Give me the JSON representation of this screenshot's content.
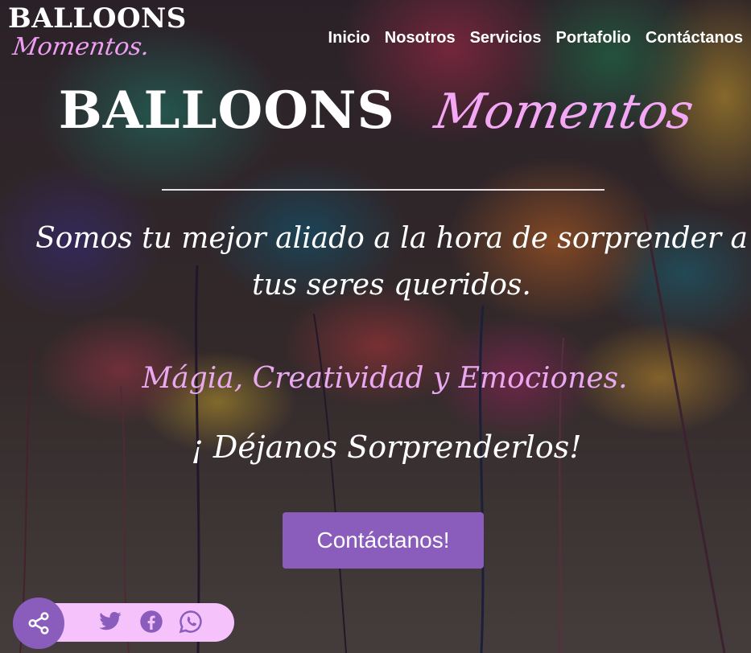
{
  "brand": {
    "name": "BALLOONS",
    "tagline": "Momentos."
  },
  "nav": {
    "items": [
      "Inicio",
      "Nosotros",
      "Servicios",
      "Portafolio",
      "Contáctanos"
    ]
  },
  "hero": {
    "title_main": "BALLOONS",
    "title_script": "Momentos",
    "tagline": "Somos tu mejor aliado a la hora de sorprender a tus seres queridos.",
    "slogan": "Mágia, Creatividad y Emociones.",
    "slogan2": "¡ Déjanos Sorprenderlos!",
    "cta_label": "Contáctanos!"
  },
  "share": {
    "icons": [
      "share-icon",
      "twitter-icon",
      "facebook-icon",
      "whatsapp-icon"
    ]
  },
  "colors": {
    "accent": "#8a5dbd",
    "pink": "#f3a7f5",
    "share_bar": "#f6c2fb",
    "social_icon": "#8a5dbd"
  }
}
